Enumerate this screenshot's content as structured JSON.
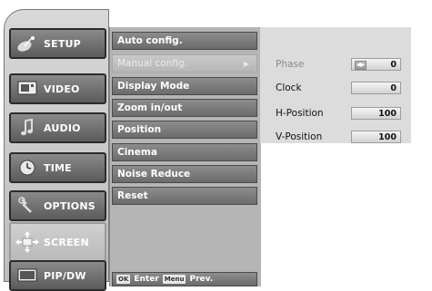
{
  "tabs": [
    {
      "label": "SETUP",
      "icon": "satellite-dish-icon",
      "active": false
    },
    {
      "label": "VIDEO",
      "icon": "tv-screen-icon",
      "active": false
    },
    {
      "label": "AUDIO",
      "icon": "music-note-icon",
      "active": false
    },
    {
      "label": "TIME",
      "icon": "clock-icon",
      "active": false
    },
    {
      "label": "OPTIONS",
      "icon": "wrench-icon",
      "active": false
    },
    {
      "label": "SCREEN",
      "icon": "screen-move-icon",
      "active": true
    },
    {
      "label": "PIP/DW",
      "icon": "pip-window-icon",
      "active": false
    }
  ],
  "menu": {
    "items": [
      {
        "label": "Auto config."
      },
      {
        "label": "Manual config.",
        "selected": true,
        "arrow": "▶"
      },
      {
        "label": "Display Mode"
      },
      {
        "label": "Zoom in/out"
      },
      {
        "label": "Position"
      },
      {
        "label": "Cinema"
      },
      {
        "label": "Noise Reduce"
      },
      {
        "label": "Reset"
      }
    ],
    "footer": {
      "ok_key": "OK",
      "enter_label": "Enter",
      "menu_key": "Menu",
      "prev_label": "Prev."
    }
  },
  "settings": [
    {
      "label": "Phase",
      "value": "0",
      "dim": true
    },
    {
      "label": "Clock",
      "value": "0"
    },
    {
      "label": "H-Position",
      "value": "100"
    },
    {
      "label": "V-Position",
      "value": "100"
    }
  ],
  "colors": {
    "panel_gray": "#b5b5b5",
    "settings_bg": "#dcdcdc",
    "tab_dark": "#5b5b5b",
    "tab_active": "#c4c4c4"
  }
}
